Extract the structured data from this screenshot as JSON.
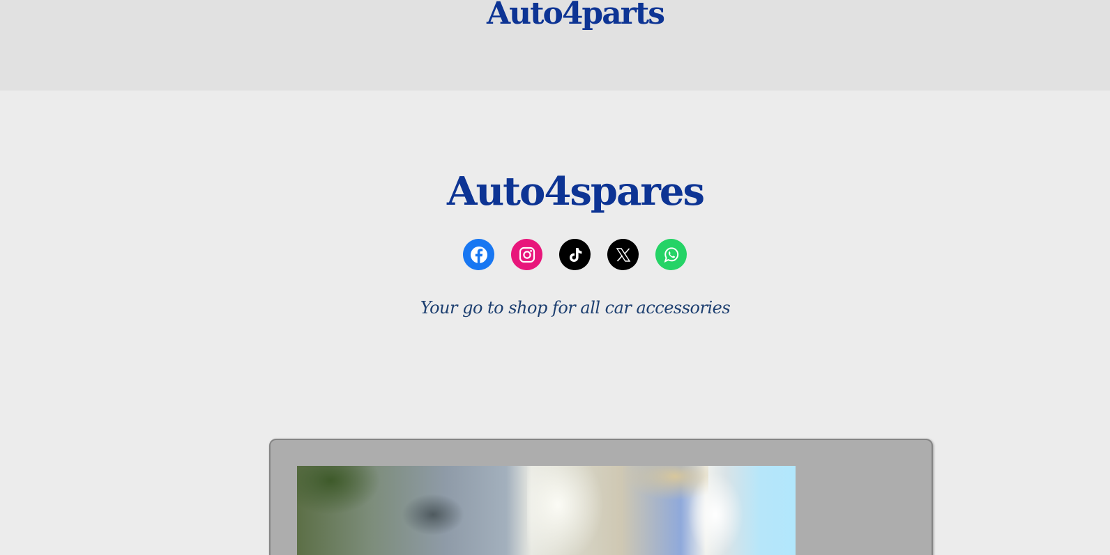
{
  "header": {
    "brand": "Auto4parts",
    "background": "#e1e1e1"
  },
  "hero": {
    "title": "Auto4spares",
    "tagline": "Your go to shop for all car accessories",
    "title_color": "#0d3494",
    "tagline_color": "#1d3f70"
  },
  "social_links": [
    {
      "name": "facebook",
      "icon": "facebook-icon",
      "color": "#1877f2"
    },
    {
      "name": "instagram",
      "icon": "instagram-icon",
      "color": "#e8167b"
    },
    {
      "name": "tiktok",
      "icon": "tiktok-icon",
      "color": "#000000"
    },
    {
      "name": "x",
      "icon": "x-icon",
      "color": "#000000"
    },
    {
      "name": "whatsapp",
      "icon": "whatsapp-icon",
      "color": "#25d366"
    }
  ],
  "gallery": {
    "frame_color": "#adadad",
    "image": "blurred-car-photo"
  }
}
